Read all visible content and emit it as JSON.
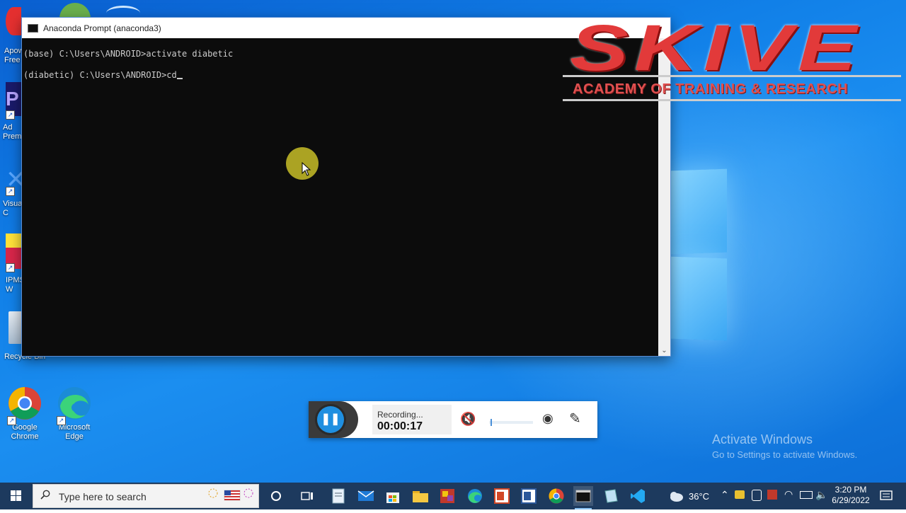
{
  "terminal": {
    "title": "Anaconda Prompt (anaconda3)",
    "lines": [
      "(base) C:\\Users\\ANDROID>activate diabetic",
      "(diabetic) C:\\Users\\ANDROID>cd"
    ]
  },
  "desktop_icons": [
    {
      "name": "Google Chrome",
      "label_line1": "Google",
      "label_line2": "Chrome"
    },
    {
      "name": "Microsoft Edge",
      "label_line1": "Microsoft",
      "label_line2": "Edge"
    }
  ],
  "partial_icons": {
    "apowersoft": "Apow\nFree",
    "premiere": "Ad\nPrem",
    "visual": "Visua\nC",
    "ipms": "IPMS\nW",
    "recycle": "Recycle Bin"
  },
  "logo": {
    "title": "SKIVE",
    "tagline": "ACADEMY OF TRAINING & RESEARCH"
  },
  "recorder": {
    "status": "Recording...",
    "time": "00:00:17",
    "volume_level": 0.03
  },
  "watermark": {
    "line1": "Activate Windows",
    "line2": "Go to Settings to activate Windows."
  },
  "taskbar": {
    "search_placeholder": "Type here to search",
    "weather": "36°C",
    "time": "3:20 PM",
    "date": "6/29/2022"
  },
  "colors": {
    "taskbar": "#1d3a5e",
    "terminal_bg": "#0c0c0c",
    "accent": "#1f8fe0",
    "logo_red": "#e23a3a"
  }
}
